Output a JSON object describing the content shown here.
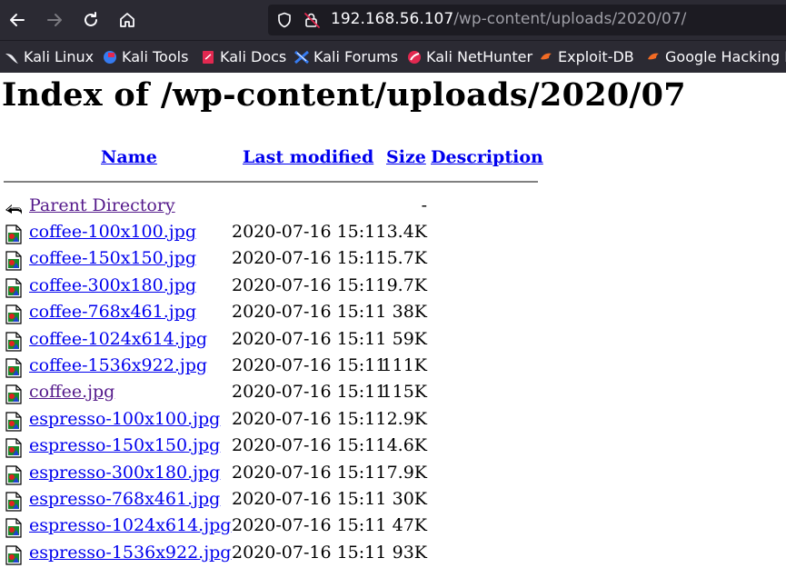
{
  "browser": {
    "url_host": "192.168.56.107",
    "url_path": "/wp-content/uploads/2020/07/",
    "bookmarks": [
      {
        "label": "Kali Linux",
        "icon": "kali-dragon-icon"
      },
      {
        "label": "Kali Tools",
        "icon": "kali-tools-icon"
      },
      {
        "label": "Kali Docs",
        "icon": "kali-docs-icon"
      },
      {
        "label": "Kali Forums",
        "icon": "kali-forums-icon"
      },
      {
        "label": "Kali NetHunter",
        "icon": "nethunter-icon"
      },
      {
        "label": "Exploit-DB",
        "icon": "exploit-db-icon"
      },
      {
        "label": "Google Hacking D",
        "icon": "ghdb-icon"
      }
    ]
  },
  "page": {
    "title": "Index of /wp-content/uploads/2020/07",
    "headers": {
      "name": "Name",
      "last_modified": "Last modified",
      "size": "Size",
      "description": "Description"
    },
    "parent": {
      "name": "Parent Directory",
      "size": "-"
    },
    "files": [
      {
        "name": "coffee-100x100.jpg",
        "date": "2020-07-16 15:11",
        "size": "3.4K",
        "visited": false
      },
      {
        "name": "coffee-150x150.jpg",
        "date": "2020-07-16 15:11",
        "size": "5.7K",
        "visited": false
      },
      {
        "name": "coffee-300x180.jpg",
        "date": "2020-07-16 15:11",
        "size": "9.7K",
        "visited": false
      },
      {
        "name": "coffee-768x461.jpg",
        "date": "2020-07-16 15:11",
        "size": "38K",
        "visited": false
      },
      {
        "name": "coffee-1024x614.jpg",
        "date": "2020-07-16 15:11",
        "size": "59K",
        "visited": false
      },
      {
        "name": "coffee-1536x922.jpg",
        "date": "2020-07-16 15:11",
        "size": "111K",
        "visited": false
      },
      {
        "name": "coffee.jpg",
        "date": "2020-07-16 15:11",
        "size": "115K",
        "visited": true
      },
      {
        "name": "espresso-100x100.jpg",
        "date": "2020-07-16 15:11",
        "size": "2.9K",
        "visited": false
      },
      {
        "name": "espresso-150x150.jpg",
        "date": "2020-07-16 15:11",
        "size": "4.6K",
        "visited": false
      },
      {
        "name": "espresso-300x180.jpg",
        "date": "2020-07-16 15:11",
        "size": "7.9K",
        "visited": false
      },
      {
        "name": "espresso-768x461.jpg",
        "date": "2020-07-16 15:11",
        "size": "30K",
        "visited": false
      },
      {
        "name": "espresso-1024x614.jpg",
        "date": "2020-07-16 15:11",
        "size": "47K",
        "visited": false
      },
      {
        "name": "espresso-1536x922.jpg",
        "date": "2020-07-16 15:11",
        "size": "93K",
        "visited": false
      }
    ]
  }
}
